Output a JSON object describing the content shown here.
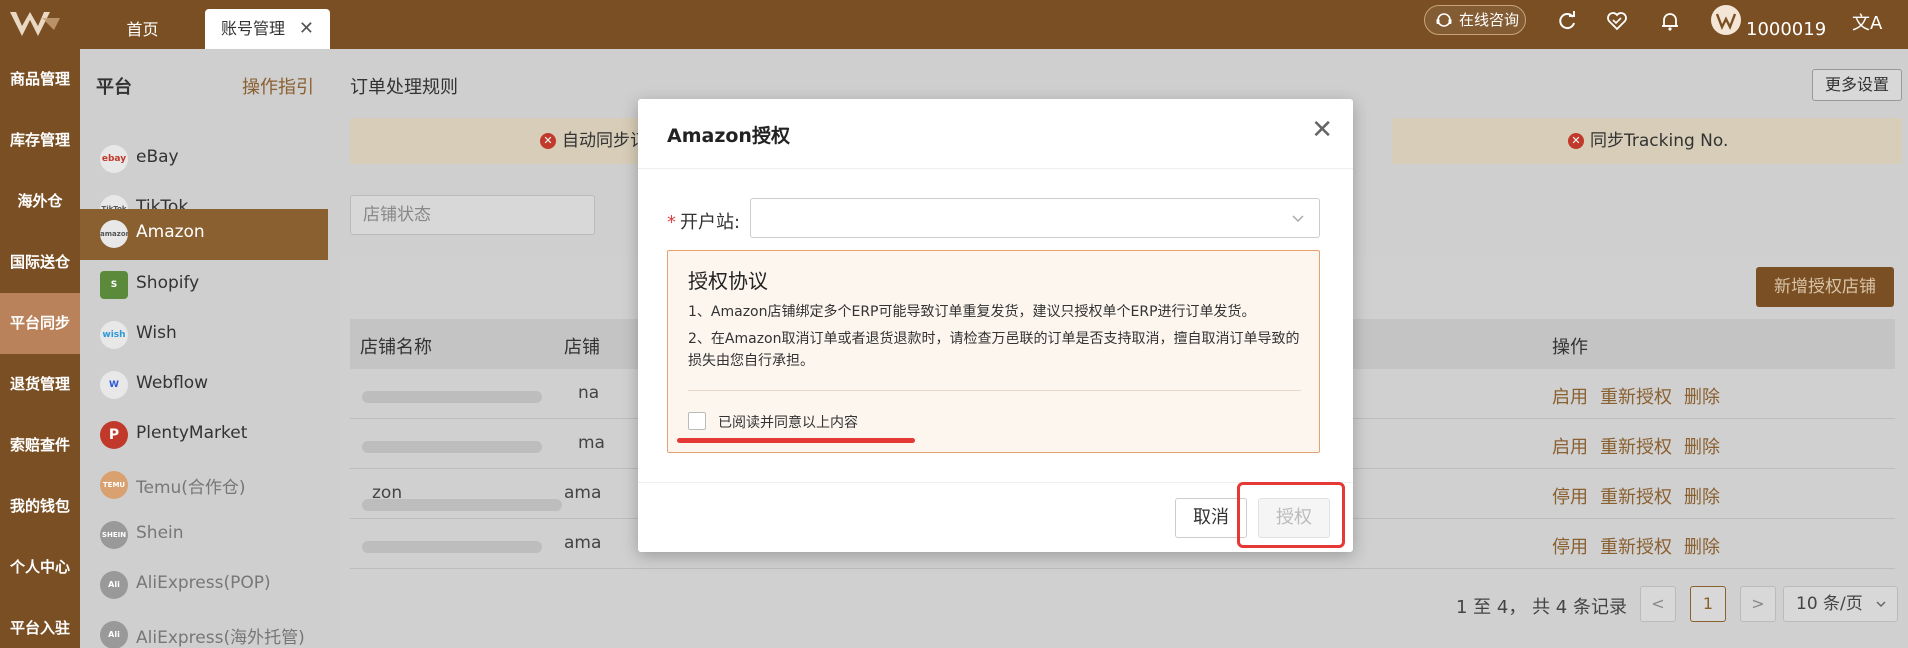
{
  "topbar": {
    "tabs": [
      {
        "label": "首页"
      },
      {
        "label": "账号管理",
        "active": true
      }
    ],
    "consult_label": "在线咨询",
    "user_id": "1000019",
    "lang_icon": "translate-icon",
    "brand_color": "#7a4f23"
  },
  "leftnav": {
    "items": [
      "商品管理",
      "库存管理",
      "海外仓",
      "国际送仓",
      "平台同步",
      "退货管理",
      "索赔查件",
      "我的钱包",
      "个人中心",
      "平台入驻"
    ],
    "active_index": 4
  },
  "platforms": {
    "title": "平台",
    "guide": "操作指引",
    "items": [
      {
        "label": "eBay",
        "logo": "ebay"
      },
      {
        "label": "TikTok",
        "logo": "TikTok"
      },
      {
        "label": "Amazon",
        "logo": "amazon",
        "active": true
      },
      {
        "label": "Shopify",
        "logo": "S"
      },
      {
        "label": "Wish",
        "logo": "wish"
      },
      {
        "label": "Webflow",
        "logo": "W"
      },
      {
        "label": "PlentyMarket",
        "logo": "P"
      },
      {
        "label": "Temu(合作仓)",
        "logo": "TEMU"
      },
      {
        "label": "Shein",
        "logo": "SHEIN"
      },
      {
        "label": "AliExpress(POP)",
        "logo": "Ali"
      },
      {
        "label": "AliExpress(海外托管)",
        "logo": "Ali"
      }
    ]
  },
  "main": {
    "rules_title": "订单处理规则",
    "more_settings": "更多设置",
    "rule_cards": [
      "自动同步订",
      "同步Tracking No."
    ],
    "filter_placeholder": "店铺状态",
    "new_store_button": "新增授权店铺",
    "table": {
      "columns": [
        "店铺名称",
        "店铺",
        "操作"
      ],
      "rows": [
        {
          "store_prefix": "",
          "store_col2": "na",
          "ops": [
            "启用",
            "重新授权",
            "删除"
          ]
        },
        {
          "store_prefix": "",
          "store_col2": "ma",
          "ops": [
            "启用",
            "重新授权",
            "删除"
          ]
        },
        {
          "store_prefix": "zon",
          "store_col2": "ama",
          "ops": [
            "停用",
            "重新授权",
            "删除"
          ]
        },
        {
          "store_prefix": "",
          "store_col2": "ama",
          "ops": [
            "停用",
            "重新授权",
            "删除"
          ]
        }
      ]
    },
    "pager": {
      "summary": "1 至 4， 共 4 条记录",
      "prev": "<",
      "current": "1",
      "next": ">",
      "page_size": "10 条/页"
    }
  },
  "modal": {
    "title": "Amazon授权",
    "field_required_mark": "*",
    "field_label": "开户站:",
    "agreement_title": "授权协议",
    "agreement_lines": [
      "1、Amazon店铺绑定多个ERP可能导致订单重复发货，建议只授权单个ERP进行订单发货。",
      "2、在Amazon取消订单或者退货退款时，请检查万邑联的订单是否支持取消，擅自取消订单导致的损失由您自行承担。"
    ],
    "checkbox_label": "已阅读并同意以上内容",
    "cancel_label": "取消",
    "authorize_label": "授权",
    "highlight_color": "#e53935"
  }
}
